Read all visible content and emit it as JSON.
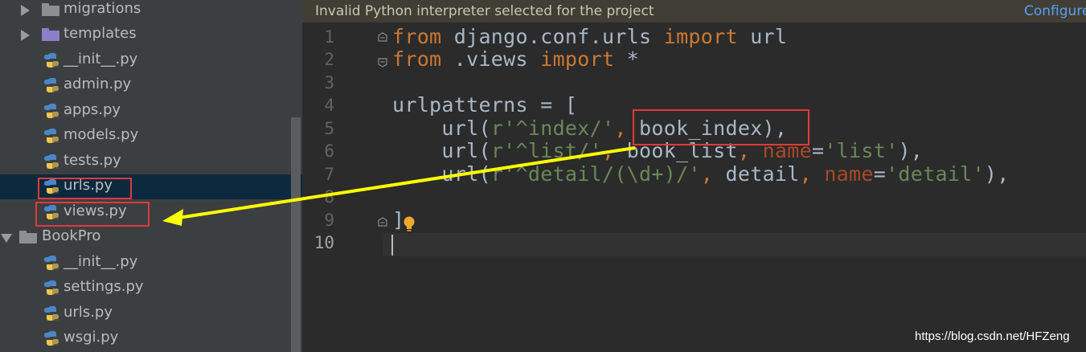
{
  "tree": {
    "items": [
      {
        "label": "migrations",
        "type": "folder"
      },
      {
        "label": "templates",
        "type": "folder"
      },
      {
        "label": "__init__.py",
        "type": "file"
      },
      {
        "label": "admin.py",
        "type": "file"
      },
      {
        "label": "apps.py",
        "type": "file"
      },
      {
        "label": "models.py",
        "type": "file"
      },
      {
        "label": "tests.py",
        "type": "file"
      },
      {
        "label": "urls.py",
        "type": "file",
        "selected": true
      },
      {
        "label": "views.py",
        "type": "file"
      },
      {
        "label": "BookPro",
        "type": "folder"
      },
      {
        "label": "__init__.py",
        "type": "file"
      },
      {
        "label": "settings.py",
        "type": "file"
      },
      {
        "label": "urls.py",
        "type": "file"
      },
      {
        "label": "wsgi.py",
        "type": "file"
      }
    ]
  },
  "banner": {
    "message": "Invalid Python interpreter selected for the project",
    "action": "Configure"
  },
  "editor": {
    "line_numbers": [
      "1",
      "2",
      "3",
      "4",
      "5",
      "6",
      "7",
      "8",
      "9",
      "10"
    ],
    "current_line": "10",
    "code": {
      "l1": {
        "kw1": "from",
        "mod": " django.conf.urls ",
        "kw2": "import",
        "name": " url"
      },
      "l2": {
        "kw1": "from",
        "mod": " .views ",
        "kw2": "import",
        "name": " *"
      },
      "l4": {
        "text": "urlpatterns = ["
      },
      "l5": {
        "pre": "    url(",
        "str": "r'^index/'",
        "comma": ", ",
        "ref": "book_index",
        "post": "),"
      },
      "l6": {
        "pre": "    url(",
        "str": "r'^list/'",
        "comma": ", ",
        "ref": "book_list",
        "comma2": ", ",
        "param": "name",
        "eq": "=",
        "str2": "'list'",
        "post": "),"
      },
      "l7": {
        "pre": "    url(",
        "str": "r'^detail/(\\d+)/'",
        "comma": ", ",
        "ref": "detail",
        "comma2": ", ",
        "param": "name",
        "eq": "=",
        "str2": "'detail'",
        "post": "),"
      },
      "l9": {
        "text": "]"
      }
    }
  },
  "watermark": "https://blog.csdn.net/HFZeng",
  "colors": {
    "annotation_red": "#e03a3a",
    "annotation_arrow": "#ffff00",
    "keyword": "#cc7832",
    "string": "#6a8759",
    "param": "#aa4926"
  }
}
